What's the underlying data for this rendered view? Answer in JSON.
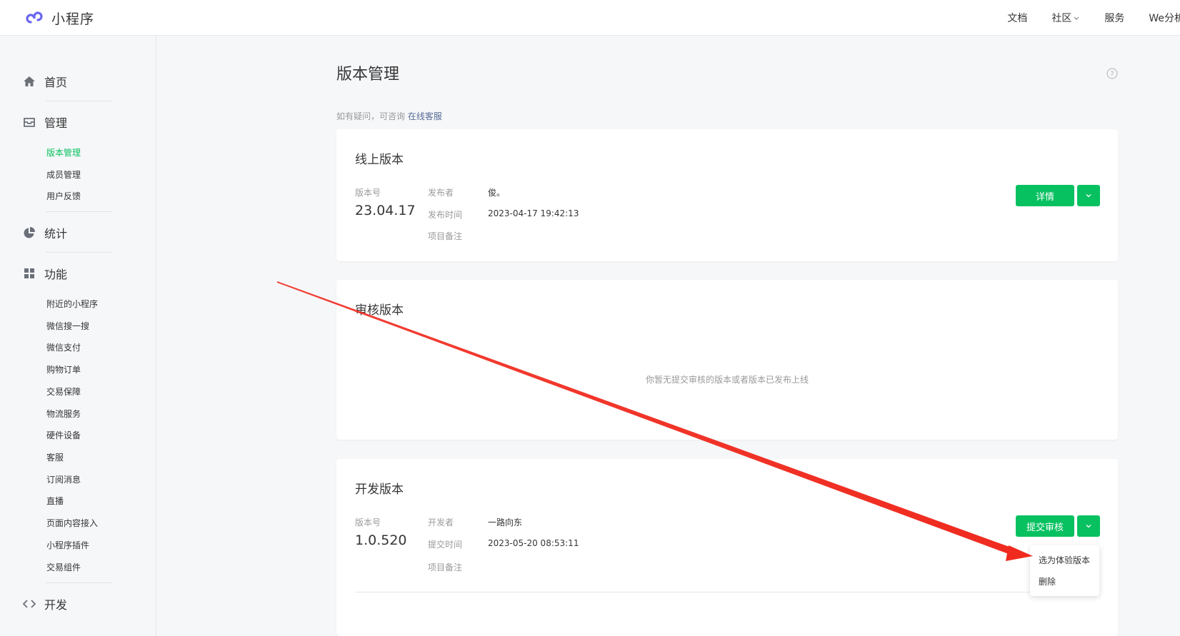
{
  "header": {
    "logo_text": "小程序",
    "nav": [
      "文档",
      "社区",
      "服务",
      "We分析"
    ]
  },
  "sidebar": {
    "home": "首页",
    "manage": {
      "label": "管理",
      "items": [
        "版本管理",
        "成员管理",
        "用户反馈"
      ]
    },
    "stats": "统计",
    "features": {
      "label": "功能",
      "items": [
        "附近的小程序",
        "微信搜一搜",
        "微信支付",
        "购物订单",
        "交易保障",
        "物流服务",
        "硬件设备",
        "客服",
        "订阅消息",
        "直播",
        "页面内容接入",
        "小程序插件",
        "交易组件"
      ]
    },
    "dev": "开发"
  },
  "main": {
    "title": "版本管理",
    "hint_prefix": "如有疑问，可咨询",
    "hint_link": "在线客服",
    "online": {
      "title": "线上版本",
      "version_label": "版本号",
      "version": "23.04.17",
      "publisher_label": "发布者",
      "publisher": "俊。",
      "time_label": "发布时间",
      "time": "2023-04-17 19:42:13",
      "note_label": "项目备注",
      "detail_button": "详情"
    },
    "review": {
      "title": "审核版本",
      "empty": "你暂无提交审核的版本或者版本已发布上线"
    },
    "dev": {
      "title": "开发版本",
      "version_label": "版本号",
      "version": "1.0.520",
      "developer_label": "开发者",
      "developer": "一路向东",
      "time_label": "提交时间",
      "time": "2023-05-20 08:53:11",
      "note_label": "项目备注",
      "submit_button": "提交审核",
      "menu": [
        "选为体验版本",
        "删除"
      ]
    }
  },
  "colors": {
    "accent": "#07c160",
    "link": "#576b95",
    "annotation": "#f02a1e"
  }
}
